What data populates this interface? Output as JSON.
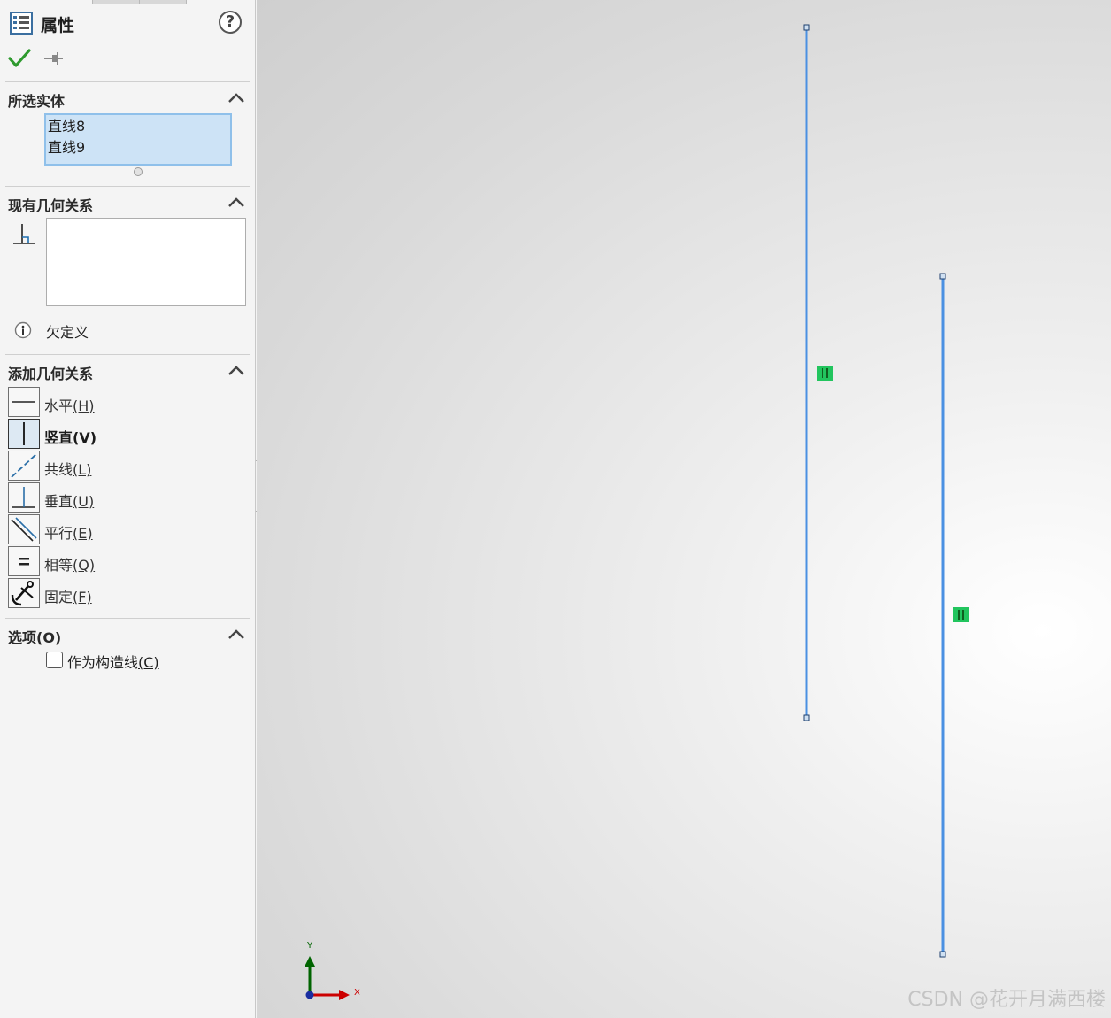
{
  "panel": {
    "title": "属性",
    "help_glyph": "?",
    "icons": {
      "header": "property-manager-icon",
      "ok": "checkmark-icon",
      "pin": "pushpin-icon",
      "help": "help-icon"
    },
    "selected_entities": {
      "title": "所选实体",
      "items": [
        "直线8",
        "直线9"
      ]
    },
    "existing_relations": {
      "title": "现有几何关系",
      "icon": "sketch-relation-icon",
      "items": [],
      "status": "欠定义",
      "status_icon": "info-icon"
    },
    "add_relations": {
      "title": "添加几何关系",
      "items": [
        {
          "label": "水平",
          "key": "(H)",
          "icon": "horizontal-icon",
          "active": false
        },
        {
          "label": "竖直",
          "key": "(V)",
          "icon": "vertical-icon",
          "active": true
        },
        {
          "label": "共线",
          "key": "(L)",
          "icon": "collinear-icon",
          "active": false
        },
        {
          "label": "垂直",
          "key": "(U)",
          "icon": "perpendicular-icon",
          "active": false
        },
        {
          "label": "平行",
          "key": "(E)",
          "icon": "parallel-icon",
          "active": false
        },
        {
          "label": "相等",
          "key": "(Q)",
          "icon": "equal-icon",
          "active": false
        },
        {
          "label": "固定",
          "key": "(F)",
          "icon": "fix-anchor-icon",
          "active": false
        }
      ]
    },
    "options": {
      "title": "选项(O)",
      "construction_label": "作为构造线",
      "construction_key": "(C)",
      "construction_checked": false
    }
  },
  "viewport": {
    "line_color": "#4a90e2",
    "relation_marker_color": "#22c55e",
    "triad": {
      "x_label": "X",
      "y_label": "Y",
      "x_color": "#cc0000",
      "y_color": "#006400"
    },
    "watermark": "CSDN @花开月满西楼"
  }
}
